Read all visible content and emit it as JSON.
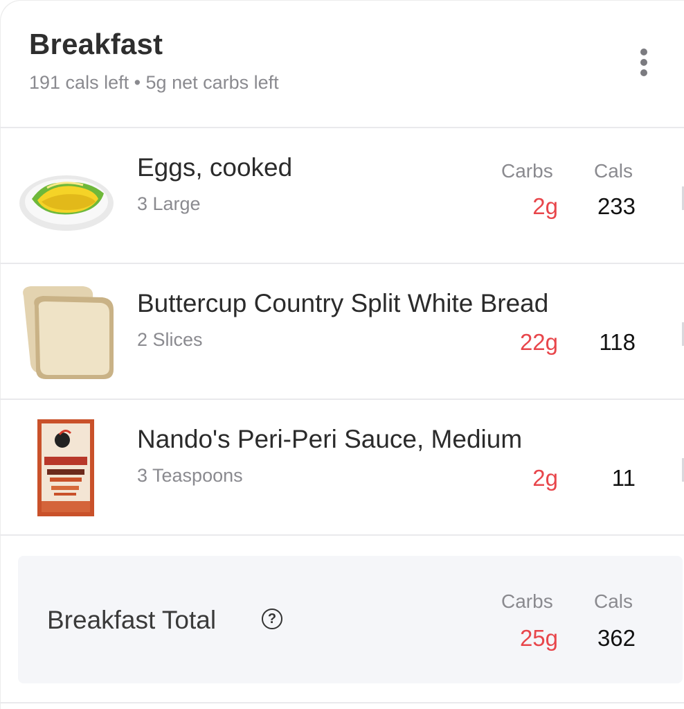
{
  "meal": {
    "title": "Breakfast",
    "summary": "191 cals left • 5g net carbs left",
    "more_icon": "more-vertical-icon"
  },
  "columns": {
    "carbs": "Carbs",
    "cals": "Cals"
  },
  "items": [
    {
      "name": "Eggs, cooked",
      "portion": "3 Large",
      "carbs": "2g",
      "cals": "233",
      "image": "eggs-plate-image"
    },
    {
      "name": "Buttercup Country Split White Bread",
      "portion": "2 Slices",
      "carbs": "22g",
      "cals": "118",
      "image": "bread-slices-image"
    },
    {
      "name": "Nando's Peri-Peri Sauce, Medium",
      "portion": "3 Teaspoons",
      "carbs": "2g",
      "cals": "11",
      "image": "sauce-bottle-image"
    }
  ],
  "total": {
    "label": "Breakfast Total",
    "carbs": "25g",
    "cals": "362",
    "help_icon": "help-circle-icon"
  },
  "colors": {
    "carbs_accent": "#e8464b",
    "muted_text": "#8a8a8f",
    "total_background": "#f5f6f9"
  }
}
